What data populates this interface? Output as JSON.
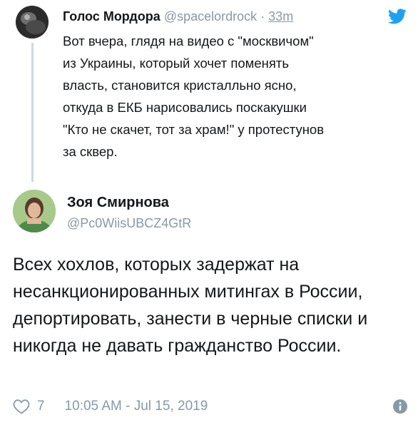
{
  "parent_tweet": {
    "author_name": "Голос Мордора",
    "handle": "@spacelordrock",
    "separator": "·",
    "time": "33m",
    "text": "Вот вчера, глядя на видео с \"москвичом\"\nиз Украины, который хочет поменять\nвласть, становится кристалльно ясно,\nоткуда в ЕКБ нарисовались поскакушки\n\"Кто не скачет, тот за храм!\" у протестунов\nза сквер."
  },
  "reply_tweet": {
    "author_name": "Зоя Смирнова",
    "handle": "@Pc0WiisUBCZ4GtR",
    "text": "Всех хохлов, которых задержат на несанкционированных митингах в России, депортировать, занести в черные списки и никогда не давать гражданство России.",
    "like_count": "7",
    "timestamp": "10:05 AM - Jul 15, 2019"
  },
  "colors": {
    "text": "#14171a",
    "muted": "#8899a6",
    "twitter_blue": "#1da1f2",
    "thread_line": "#cfd9de"
  },
  "icons": {
    "brand": "twitter-bird-icon",
    "like": "heart-icon",
    "info": "info-icon"
  }
}
